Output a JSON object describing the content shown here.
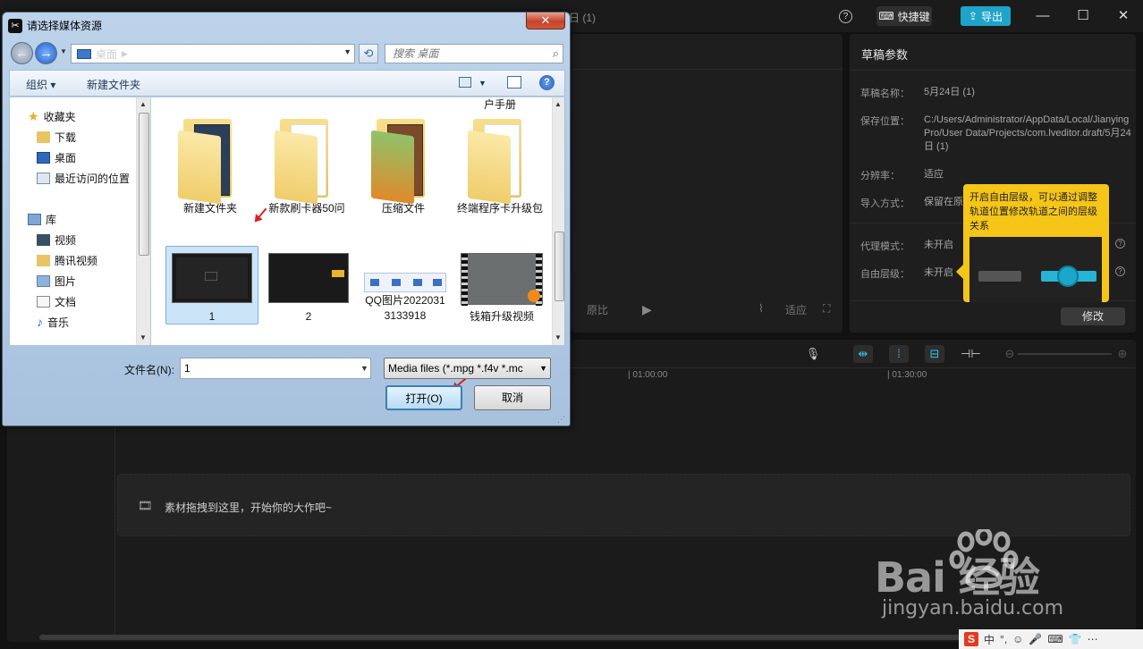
{
  "editor": {
    "title_fragment": "日 (1)",
    "help": "?",
    "shortcut_label": "快捷键",
    "export_label": "导出",
    "window_controls": [
      "—",
      "☐",
      "✕"
    ],
    "preview_controls": [
      "原比",
      "适应"
    ],
    "draft": {
      "title": "草稿参数",
      "fields": [
        {
          "label": "草稿名称：",
          "value": "5月24日 (1)"
        },
        {
          "label": "保存位置：",
          "value": "C:/Users/Administrator/AppData/Local/JianyingPro/User Data/Projects/com.lveditor.draft/5月24日 (1)"
        },
        {
          "label": "分辨率：",
          "value": "适应"
        },
        {
          "label": "导入方式：",
          "value": "保留在原"
        },
        {
          "label": "代理模式：",
          "value": "未开启"
        },
        {
          "label": "自由层级：",
          "value": "未开启"
        }
      ],
      "edit_label": "修改"
    },
    "tooltip": "开启自由层级，可以通过调整轨道位置修改轨道之间的层级关系",
    "timeline": {
      "ticks": [
        "| 01:00:00",
        "| 01:30:00"
      ],
      "drop_hint": "素材拖拽到这里，开始你的大作吧~"
    }
  },
  "watermark": {
    "brand": "Bai  经验",
    "url": "jingyan.baidu.com"
  },
  "tray": {
    "items": [
      "S",
      "中",
      "°,",
      "☺",
      "🎤",
      "⌨",
      "👕",
      "⋯"
    ]
  },
  "dialog": {
    "title": "请选择媒体资源",
    "close": "✕",
    "address": "桌面",
    "search_placeholder": "搜索 桌面",
    "toolbar": {
      "organize": "组织 ▾",
      "new_folder": "新建文件夹"
    },
    "nav": {
      "favorites_header": "收藏夹",
      "favorites": [
        "下载",
        "桌面",
        "最近访问的位置"
      ],
      "libraries_header": "库",
      "libraries": [
        "视频",
        "腾讯视频",
        "图片",
        "文档",
        "音乐"
      ]
    },
    "partial_label": "户手册",
    "files": [
      {
        "name": "新建文件夹",
        "kind": "folder"
      },
      {
        "name": "新款刷卡器50问",
        "kind": "folder"
      },
      {
        "name": "压缩文件",
        "kind": "folder"
      },
      {
        "name": "终端程序卡升级包",
        "kind": "folder"
      },
      {
        "name": "1",
        "kind": "video"
      },
      {
        "name": "2",
        "kind": "video"
      },
      {
        "name": "QQ图片20220313133918",
        "kind": "image"
      },
      {
        "name": "钱箱升级视频",
        "kind": "video"
      }
    ],
    "filename_label": "文件名(N):",
    "filename_value": "1",
    "filetype": "Media files (*.mpg *.f4v *.mc",
    "open_label": "打开(O)",
    "cancel_label": "取消"
  }
}
